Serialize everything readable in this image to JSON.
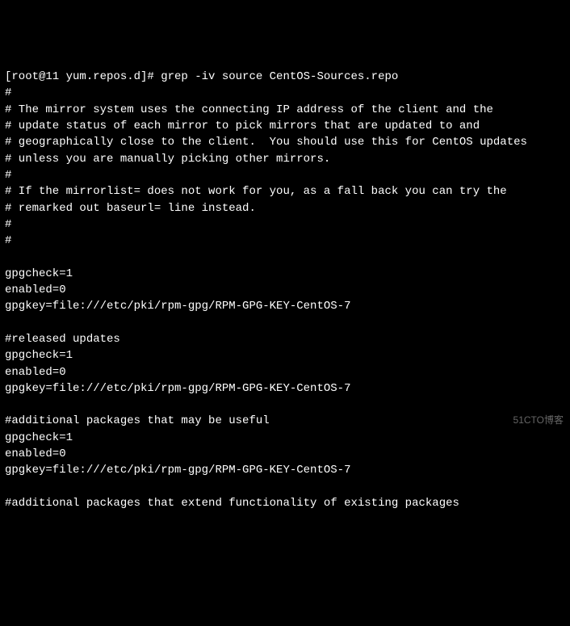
{
  "terminal": {
    "lines": [
      "[root@11 yum.repos.d]# grep -iv source CentOS-Sources.repo",
      "#",
      "# The mirror system uses the connecting IP address of the client and the",
      "# update status of each mirror to pick mirrors that are updated to and",
      "# geographically close to the client.  You should use this for CentOS updates",
      "# unless you are manually picking other mirrors.",
      "#",
      "# If the mirrorlist= does not work for you, as a fall back you can try the",
      "# remarked out baseurl= line instead.",
      "#",
      "#",
      "",
      "gpgcheck=1",
      "enabled=0",
      "gpgkey=file:///etc/pki/rpm-gpg/RPM-GPG-KEY-CentOS-7",
      "",
      "#released updates",
      "gpgcheck=1",
      "enabled=0",
      "gpgkey=file:///etc/pki/rpm-gpg/RPM-GPG-KEY-CentOS-7",
      "",
      "#additional packages that may be useful",
      "gpgcheck=1",
      "enabled=0",
      "gpgkey=file:///etc/pki/rpm-gpg/RPM-GPG-KEY-CentOS-7",
      "",
      "#additional packages that extend functionality of existing packages"
    ]
  },
  "watermark": {
    "text": "51CTO博客"
  }
}
